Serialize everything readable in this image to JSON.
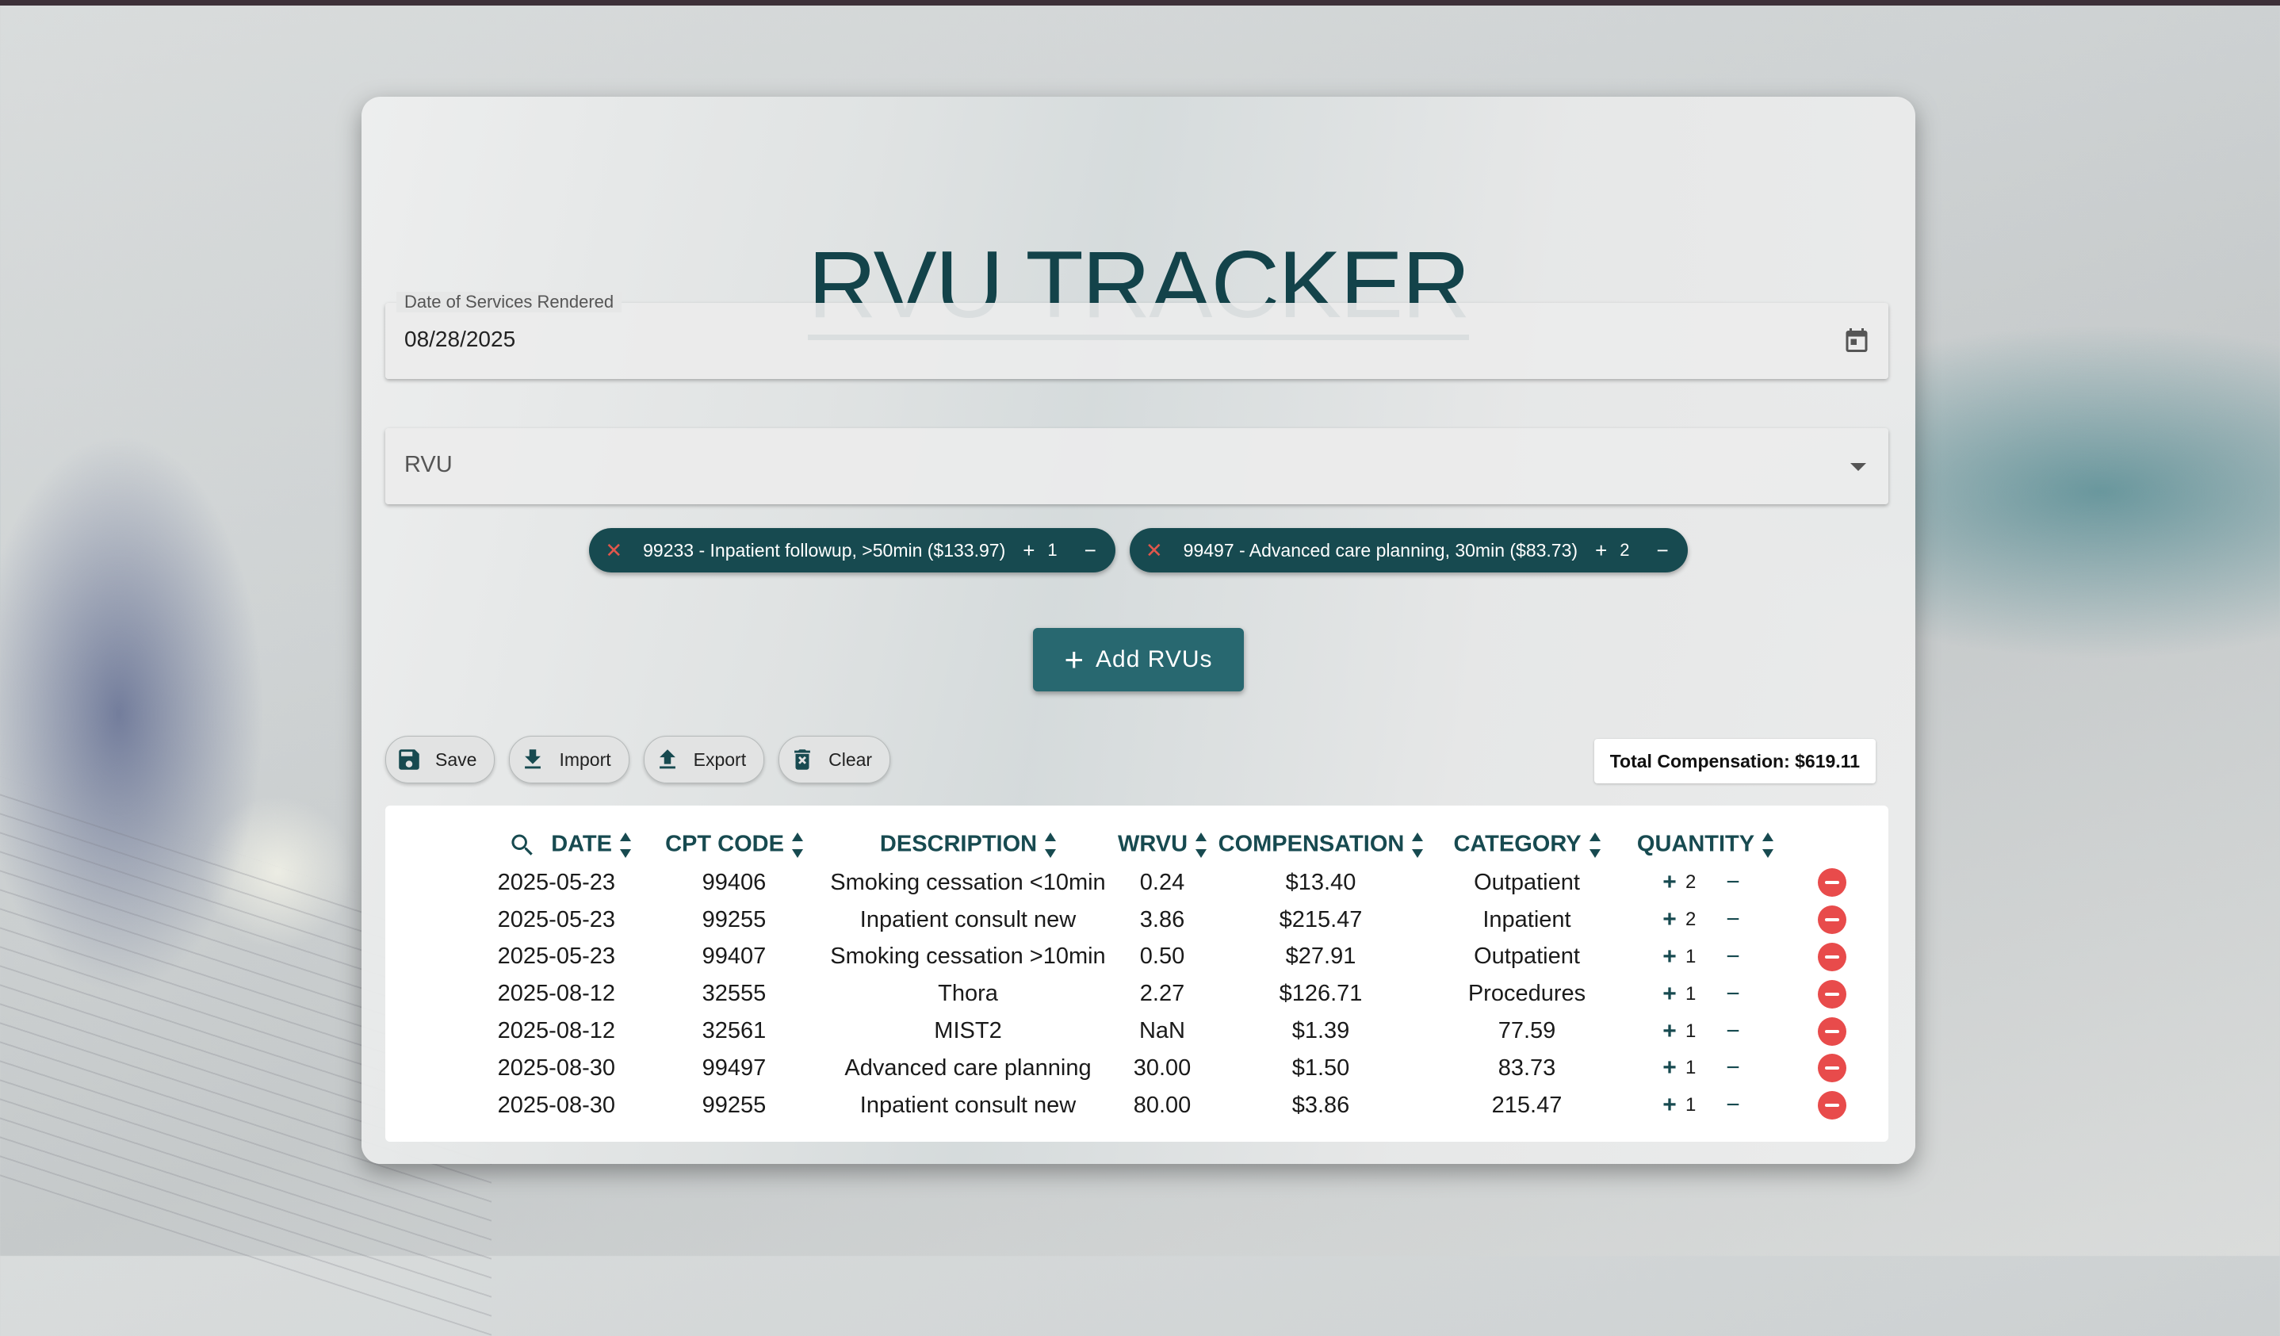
{
  "app": {
    "title": "RVU TRACKER"
  },
  "date_field": {
    "label": "Date of Services Rendered",
    "value": "08/28/2025"
  },
  "rvu_field": {
    "placeholder": "RVU"
  },
  "chips": [
    {
      "label": "99233 - Inpatient followup, >50min ($133.97)",
      "qty": "1"
    },
    {
      "label": "99497 - Advanced care planning, 30min ($83.73)",
      "qty": "2"
    }
  ],
  "add_button": {
    "label": "Add RVUs"
  },
  "toolbar": {
    "save": "Save",
    "import": "Import",
    "export": "Export",
    "clear": "Clear"
  },
  "total": "Total Compensation: $619.11",
  "table": {
    "headers": [
      "DATE",
      "CPT CODE",
      "DESCRIPTION",
      "WRVU",
      "COMPENSATION",
      "CATEGORY",
      "QUANTITY"
    ],
    "rows": [
      {
        "date": "2025-05-23",
        "cpt": "99406",
        "desc": "Smoking cessation <10min",
        "wrvu": "0.24",
        "comp": "$13.40",
        "cat": "Outpatient",
        "qty": "2"
      },
      {
        "date": "2025-05-23",
        "cpt": "99255",
        "desc": "Inpatient consult new",
        "wrvu": "3.86",
        "comp": "$215.47",
        "cat": "Inpatient",
        "qty": "2"
      },
      {
        "date": "2025-05-23",
        "cpt": "99407",
        "desc": "Smoking cessation >10min",
        "wrvu": "0.50",
        "comp": "$27.91",
        "cat": "Outpatient",
        "qty": "1"
      },
      {
        "date": "2025-08-12",
        "cpt": "32555",
        "desc": "Thora",
        "wrvu": "2.27",
        "comp": "$126.71",
        "cat": "Procedures",
        "qty": "1"
      },
      {
        "date": "2025-08-12",
        "cpt": "32561",
        "desc": "MIST2",
        "wrvu": "NaN",
        "comp": "$1.39",
        "cat": "77.59",
        "qty": "1"
      },
      {
        "date": "2025-08-30",
        "cpt": "99497",
        "desc": "Advanced care planning",
        "wrvu": "30.00",
        "comp": "$1.50",
        "cat": "83.73",
        "qty": "1"
      },
      {
        "date": "2025-08-30",
        "cpt": "99255",
        "desc": "Inpatient consult new",
        "wrvu": "80.00",
        "comp": "$3.86",
        "cat": "215.47",
        "qty": "1"
      }
    ]
  },
  "colors": {
    "accent": "#174a50",
    "button": "#286870",
    "danger": "#e84b4b"
  }
}
